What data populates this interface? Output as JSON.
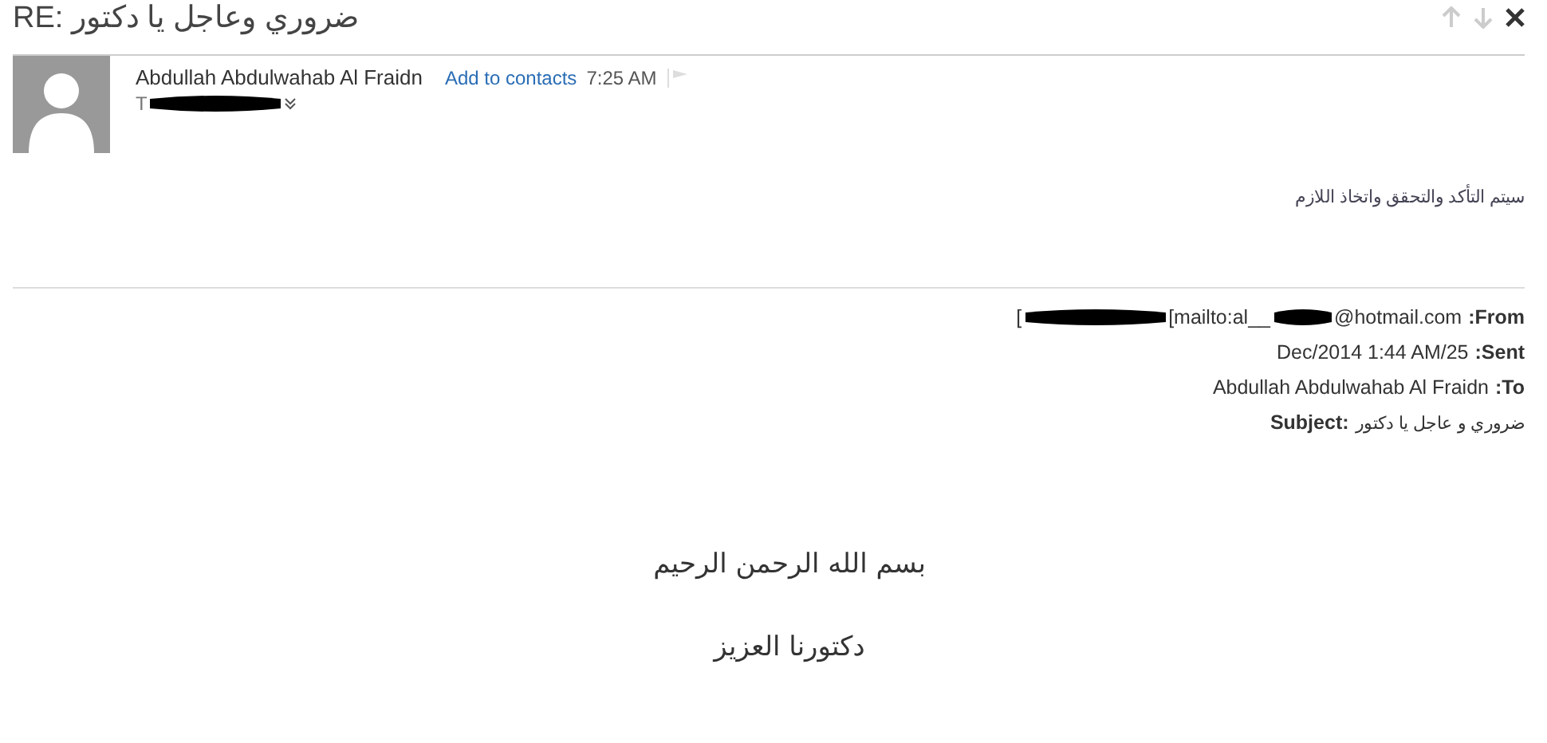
{
  "message": {
    "subject": "RE: ضروري وعاجل يا دكتور",
    "sender": "Abdullah Abdulwahab Al Fraidn",
    "add_contact": "Add to contacts",
    "time": "7:25 AM",
    "to_label": "T"
  },
  "body": {
    "reply": "سيتم التأكد والتحقق واتخاذ اللازم",
    "quoted_header": [
      {
        "kind": "redacted",
        "label": ":From",
        "before": "[",
        "value": "[mailto:al__",
        "after": "@hotmail.com"
      },
      {
        "kind": "plain",
        "label": ":Sent",
        "value": "Dec/2014 1:44 AM/25"
      },
      {
        "kind": "plain",
        "label": ":To",
        "value": "Abdullah Abdulwahab Al Fraidn"
      },
      {
        "kind": "arabic",
        "label": "Subject:",
        "value": "ضروري و عاجل يا دكتور"
      }
    ],
    "greeting": [
      "بسم الله الرحمن الرحيم",
      "دكتورنا العزيز"
    ]
  }
}
